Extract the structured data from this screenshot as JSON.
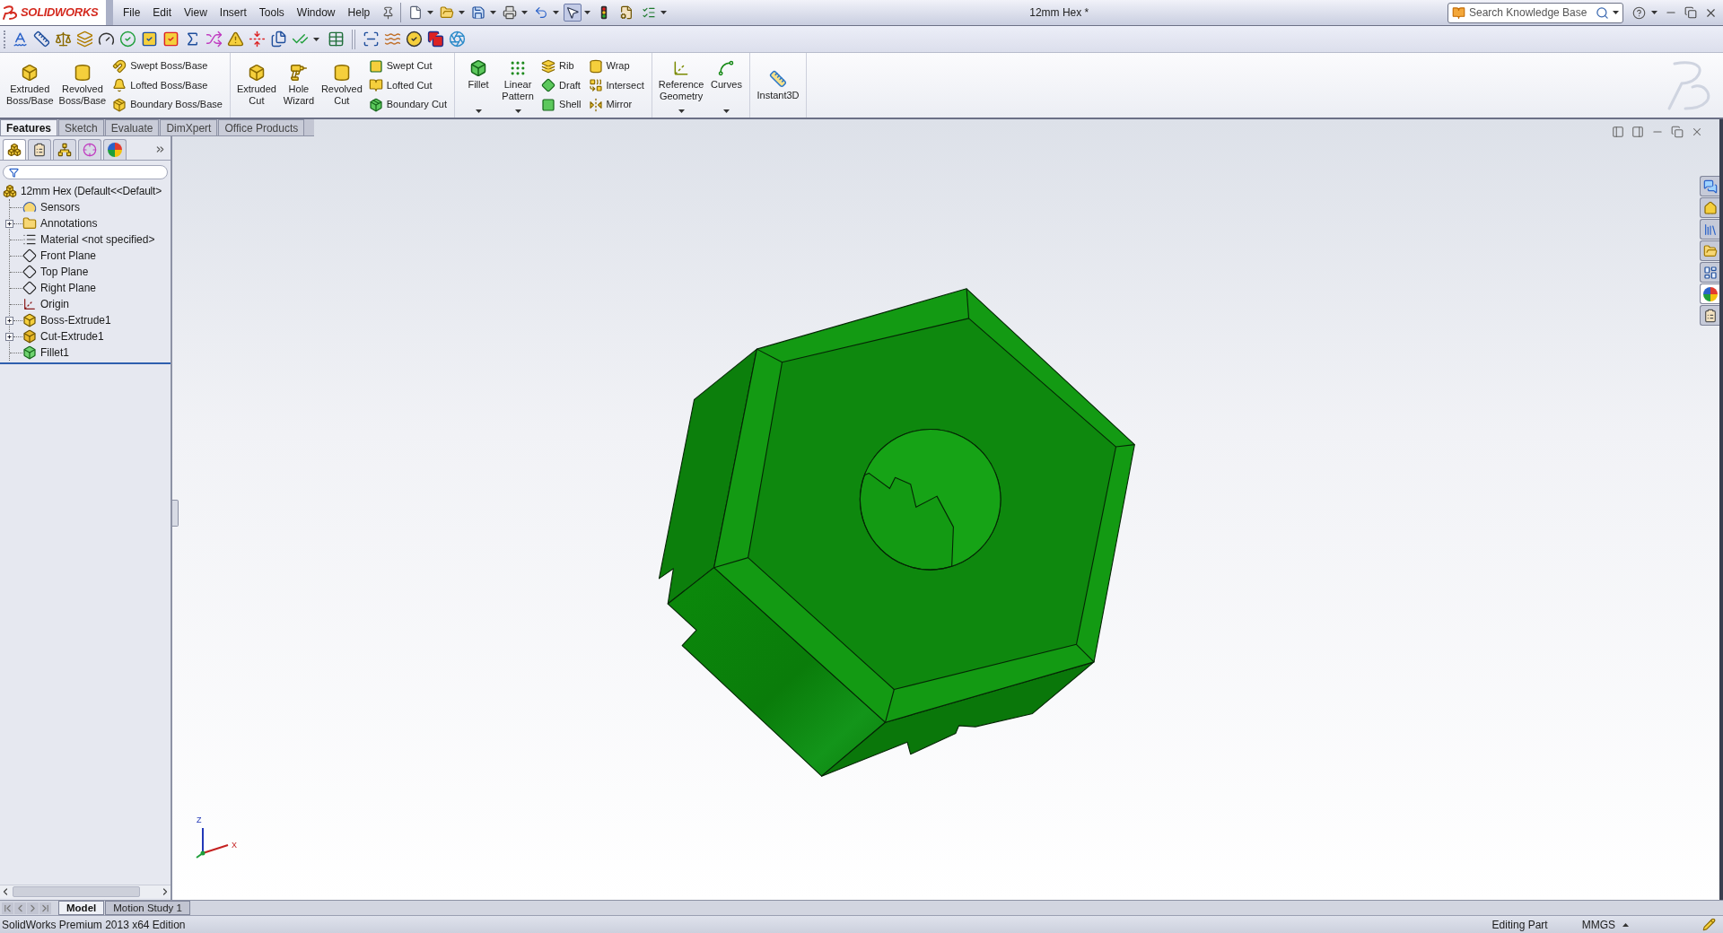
{
  "app": {
    "brand": "SOLIDWORKS"
  },
  "menu": [
    "File",
    "Edit",
    "View",
    "Insert",
    "Tools",
    "Window",
    "Help"
  ],
  "quick_access": [
    {
      "kind": "new",
      "pressed": false
    },
    {
      "kind": "open",
      "pressed": false
    },
    {
      "kind": "save",
      "pressed": false
    },
    {
      "kind": "print",
      "pressed": false
    },
    {
      "kind": "undo",
      "pressed": false
    },
    {
      "kind": "select",
      "pressed": true
    },
    {
      "kind": "rebuild",
      "pressed": false
    },
    {
      "kind": "options",
      "pressed": false
    },
    {
      "kind": "checklist",
      "pressed": false
    }
  ],
  "window": {
    "title": "12mm Hex *"
  },
  "search": {
    "placeholder": "Search Knowledge Base"
  },
  "command_manager": {
    "groups": [
      {
        "large": [
          {
            "label": "Extruded Boss/Base",
            "dropdown": false
          },
          {
            "label": "Revolved Boss/Base",
            "dropdown": false
          }
        ],
        "stacks": [
          [
            "Swept Boss/Base",
            "Lofted Boss/Base",
            "Boundary Boss/Base"
          ]
        ]
      },
      {
        "large": [
          {
            "label": "Extruded Cut",
            "dropdown": false
          },
          {
            "label": "Hole Wizard",
            "dropdown": false
          },
          {
            "label": "Revolved Cut",
            "dropdown": false
          }
        ],
        "stacks": [
          [
            "Swept Cut",
            "Lofted Cut",
            "Boundary Cut"
          ]
        ]
      },
      {
        "large": [
          {
            "label": "Fillet",
            "dropdown": true
          },
          {
            "label": "Linear Pattern",
            "dropdown": true
          }
        ],
        "stacks": [
          [
            "Rib",
            "Draft",
            "Shell"
          ],
          [
            "Wrap",
            "Intersect",
            "Mirror"
          ]
        ]
      },
      {
        "large": [
          {
            "label": "Reference Geometry",
            "dropdown": true
          },
          {
            "label": "Curves",
            "dropdown": true
          }
        ]
      },
      {
        "large": [
          {
            "label": "Instant3D",
            "dropdown": false
          }
        ]
      }
    ]
  },
  "tabs": [
    {
      "label": "Features",
      "selected": true
    },
    {
      "label": "Sketch",
      "selected": false
    },
    {
      "label": "Evaluate",
      "selected": false
    },
    {
      "label": "DimXpert",
      "selected": false
    },
    {
      "label": "Office Products",
      "selected": false
    }
  ],
  "feature_tree": {
    "panel_tabs": [
      {
        "kind": "feature-manager",
        "selected": true
      },
      {
        "kind": "property-manager",
        "selected": false
      },
      {
        "kind": "configuration-manager",
        "selected": false
      },
      {
        "kind": "dimxpert-manager",
        "selected": false
      },
      {
        "kind": "display-manager",
        "selected": false
      }
    ],
    "root": {
      "label": "12mm Hex (Default<<Default>",
      "children": [
        {
          "label": "Sensors",
          "kind": "sensors",
          "expandable": false
        },
        {
          "label": "Annotations",
          "kind": "annotations",
          "expandable": true
        },
        {
          "label": "Material <not specified>",
          "kind": "material",
          "expandable": false
        },
        {
          "label": "Front Plane",
          "kind": "plane",
          "expandable": false
        },
        {
          "label": "Top Plane",
          "kind": "plane",
          "expandable": false
        },
        {
          "label": "Right Plane",
          "kind": "plane",
          "expandable": false
        },
        {
          "label": "Origin",
          "kind": "origin",
          "expandable": false
        },
        {
          "label": "Boss-Extrude1",
          "kind": "boss-extrude",
          "expandable": true
        },
        {
          "label": "Cut-Extrude1",
          "kind": "cut-extrude",
          "expandable": true
        },
        {
          "label": "Fillet1",
          "kind": "fillet",
          "expandable": false
        }
      ]
    }
  },
  "viewport": {
    "axis_labels": [
      "Z",
      "X"
    ]
  },
  "task_pane": [
    {
      "kind": "forum",
      "selected": false
    },
    {
      "kind": "resources",
      "selected": false
    },
    {
      "kind": "design-library",
      "selected": false
    },
    {
      "kind": "file-explorer",
      "selected": false
    },
    {
      "kind": "view-palette",
      "selected": false
    },
    {
      "kind": "appearances",
      "selected": true
    },
    {
      "kind": "custom-properties",
      "selected": false
    }
  ],
  "bottom_tabs": [
    {
      "label": "Model",
      "selected": true
    },
    {
      "label": "Motion Study 1",
      "selected": false
    }
  ],
  "status_bar": {
    "edition": "SolidWorks Premium 2013 x64 Edition",
    "mode": "Editing Part",
    "units": "MMGS"
  }
}
